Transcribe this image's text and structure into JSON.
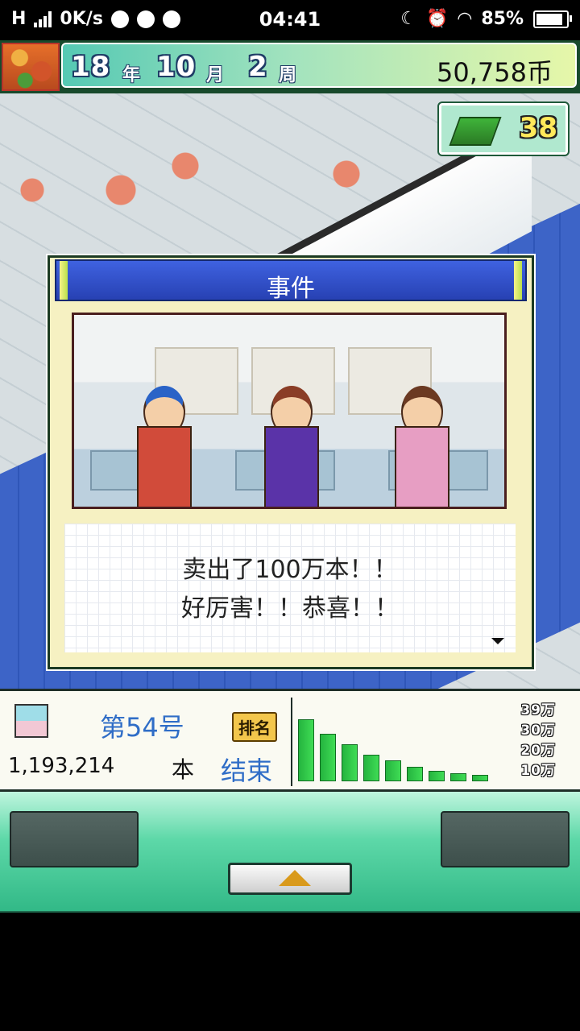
{
  "status": {
    "network": "H",
    "speed": "0K/s",
    "time": "04:41",
    "battery": "85%"
  },
  "header": {
    "year_num": "18",
    "year_unit": "年",
    "month_num": "10",
    "month_unit": "月",
    "week_num": "2",
    "week_unit": "周",
    "money": "50,758币"
  },
  "points_badge": {
    "value": "38"
  },
  "dialog": {
    "title": "事件",
    "line1": "卖出了100万本！！",
    "line2": "好厉害！！恭喜！！"
  },
  "sales": {
    "issue": "第54号",
    "rank_label": "排名",
    "copies": "1,193,214",
    "copies_unit": "本",
    "status": "结束",
    "tick_labels": [
      "39万",
      "30万",
      "20万",
      "10万"
    ]
  },
  "chart_data": {
    "type": "bar",
    "categories": [
      "1",
      "2",
      "3",
      "4",
      "5",
      "6",
      "7",
      "8",
      "9"
    ],
    "values": [
      30,
      23,
      18,
      13,
      10,
      7,
      5,
      4,
      3
    ],
    "ylim": [
      0,
      39
    ]
  },
  "colors": {
    "accent_green": "#32b987",
    "dialog_blue": "#3f62e0",
    "bar_green": "#25b43f"
  }
}
